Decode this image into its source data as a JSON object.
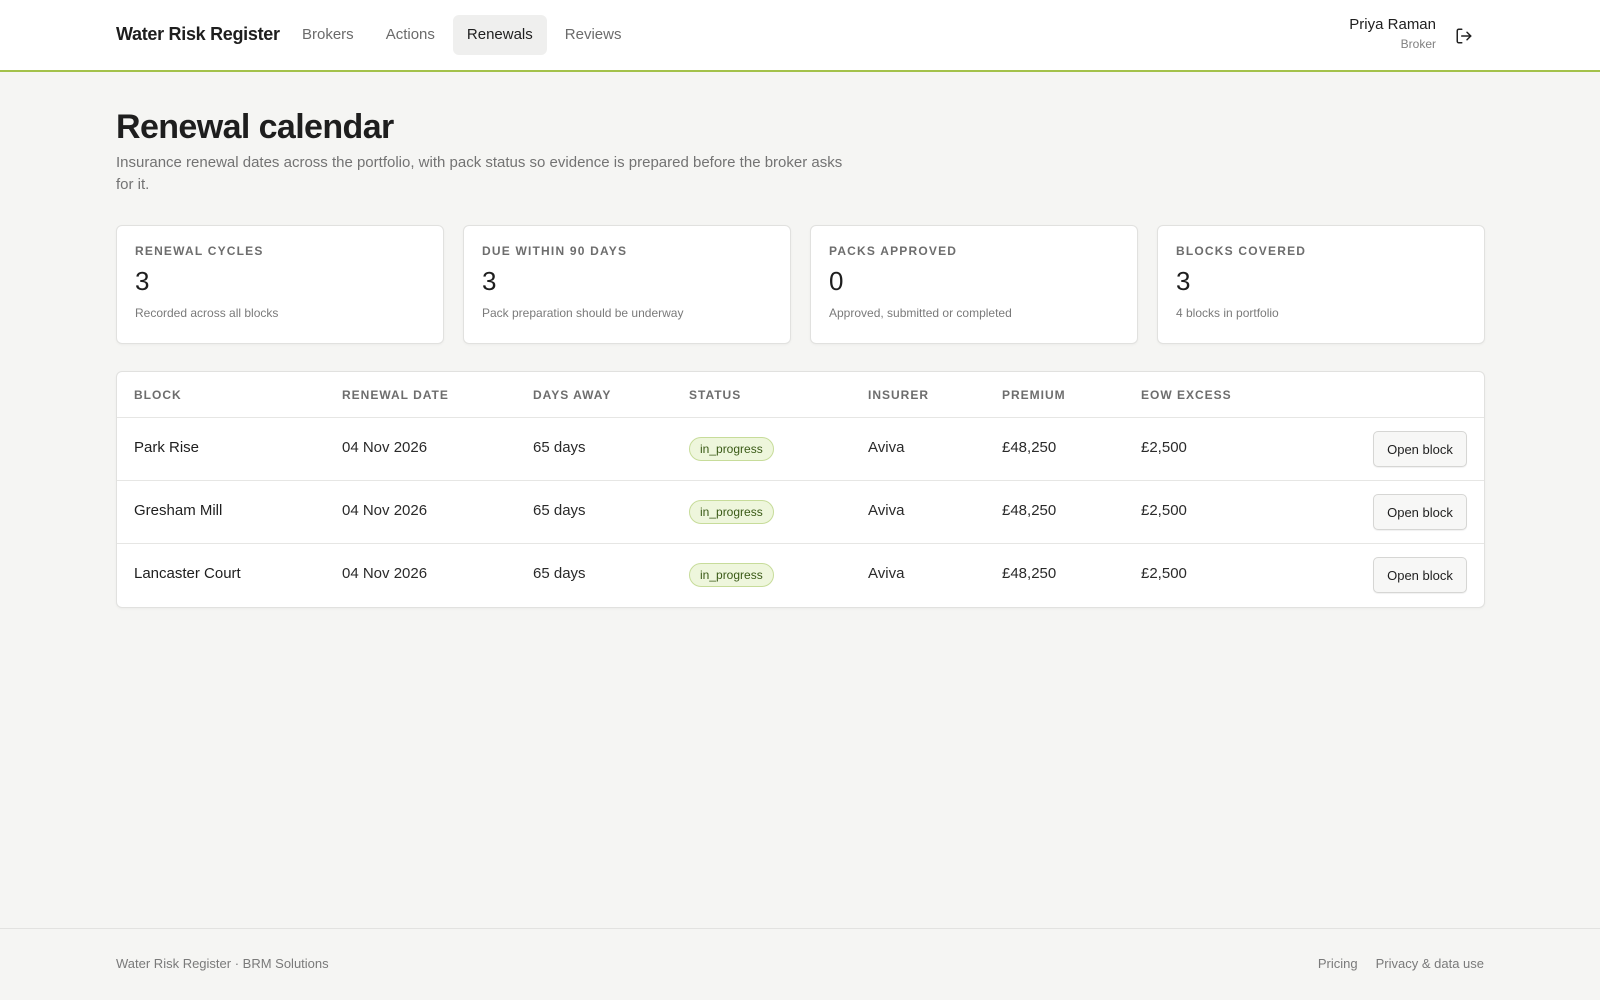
{
  "header": {
    "brand": "Water Risk Register",
    "nav": [
      {
        "label": "Brokers",
        "active": false
      },
      {
        "label": "Actions",
        "active": false
      },
      {
        "label": "Renewals",
        "active": true
      },
      {
        "label": "Reviews",
        "active": false
      }
    ],
    "user": {
      "name": "Priya Raman",
      "role": "Broker"
    },
    "logout_icon": "logout-icon"
  },
  "page": {
    "title": "Renewal calendar",
    "subtitle": "Insurance renewal dates across the portfolio, with pack status so evidence is prepared before the broker asks for it."
  },
  "cards": [
    {
      "label": "Renewal cycles",
      "value": "3",
      "note": "Recorded across all blocks"
    },
    {
      "label": "Due within 90 days",
      "value": "3",
      "note": "Pack preparation should be underway"
    },
    {
      "label": "Packs approved",
      "value": "0",
      "note": "Approved, submitted or completed"
    },
    {
      "label": "Blocks covered",
      "value": "3",
      "note": "4 blocks in portfolio"
    }
  ],
  "table": {
    "columns": [
      "Block",
      "Renewal date",
      "Days away",
      "Status",
      "Insurer",
      "Premium",
      "EOW excess"
    ],
    "action_label": "Open block",
    "rows": [
      {
        "block": "Park Rise",
        "renewal_date": "04 Nov 2026",
        "days_away": "65 days",
        "status": "in_progress",
        "insurer": "Aviva",
        "premium": "£48,250",
        "eow_excess": "£2,500"
      },
      {
        "block": "Gresham Mill",
        "renewal_date": "04 Nov 2026",
        "days_away": "65 days",
        "status": "in_progress",
        "insurer": "Aviva",
        "premium": "£48,250",
        "eow_excess": "£2,500"
      },
      {
        "block": "Lancaster Court",
        "renewal_date": "04 Nov 2026",
        "days_away": "65 days",
        "status": "in_progress",
        "insurer": "Aviva",
        "premium": "£48,250",
        "eow_excess": "£2,500"
      }
    ]
  },
  "footer": {
    "left": "Water Risk Register · BRM Solutions",
    "links": [
      "Pricing",
      "Privacy & data use"
    ]
  },
  "colors": {
    "accent": "#a3c14a",
    "badge_bg": "#eef6dc",
    "badge_text": "#3a5a16",
    "background": "#f5f5f3"
  }
}
